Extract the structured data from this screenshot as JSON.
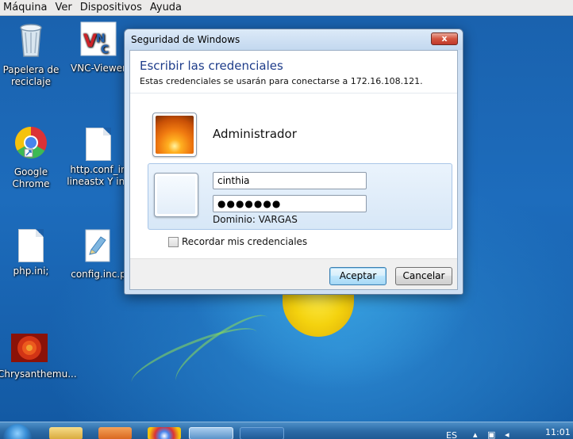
{
  "vm_menu": {
    "items": [
      "Máquina",
      "Ver",
      "Dispositivos",
      "Ayuda"
    ]
  },
  "desktop": {
    "icons": [
      {
        "label": "Papelera de reciclaje",
        "icon": "recycle-bin-icon"
      },
      {
        "label": "VNC-Viewer",
        "icon": "vnc-viewer-icon"
      },
      {
        "label": "Google Chrome",
        "icon": "chrome-icon"
      },
      {
        "label": "http.conf_in lineastx Y inc",
        "icon": "file-icon"
      },
      {
        "label": "php.ini;",
        "icon": "file-icon"
      },
      {
        "label": "config.inc.p",
        "icon": "script-file-icon"
      },
      {
        "label": "Chrysanthemu...",
        "icon": "image-thumbnail-icon"
      }
    ]
  },
  "dialog": {
    "window_title": "Seguridad de Windows",
    "close_label": "x",
    "heading": "Escribir las credenciales",
    "subheading": "Estas credenciales se usarán para conectarse a 172.16.108.121.",
    "saved_user": "Administrador",
    "username_value": "cinthia",
    "password_value": "●●●●●●●",
    "domain_text": "Dominio: VARGAS",
    "remember_label": "Recordar mis credenciales",
    "remember_checked": false,
    "ok_label": "Aceptar",
    "cancel_label": "Cancelar"
  },
  "taskbar": {
    "language": "ES",
    "clock": "11:01"
  },
  "colors": {
    "desktop_blue": "#1b5fa8",
    "heading_blue": "#1e3c8a",
    "close_red": "#c0392b"
  }
}
